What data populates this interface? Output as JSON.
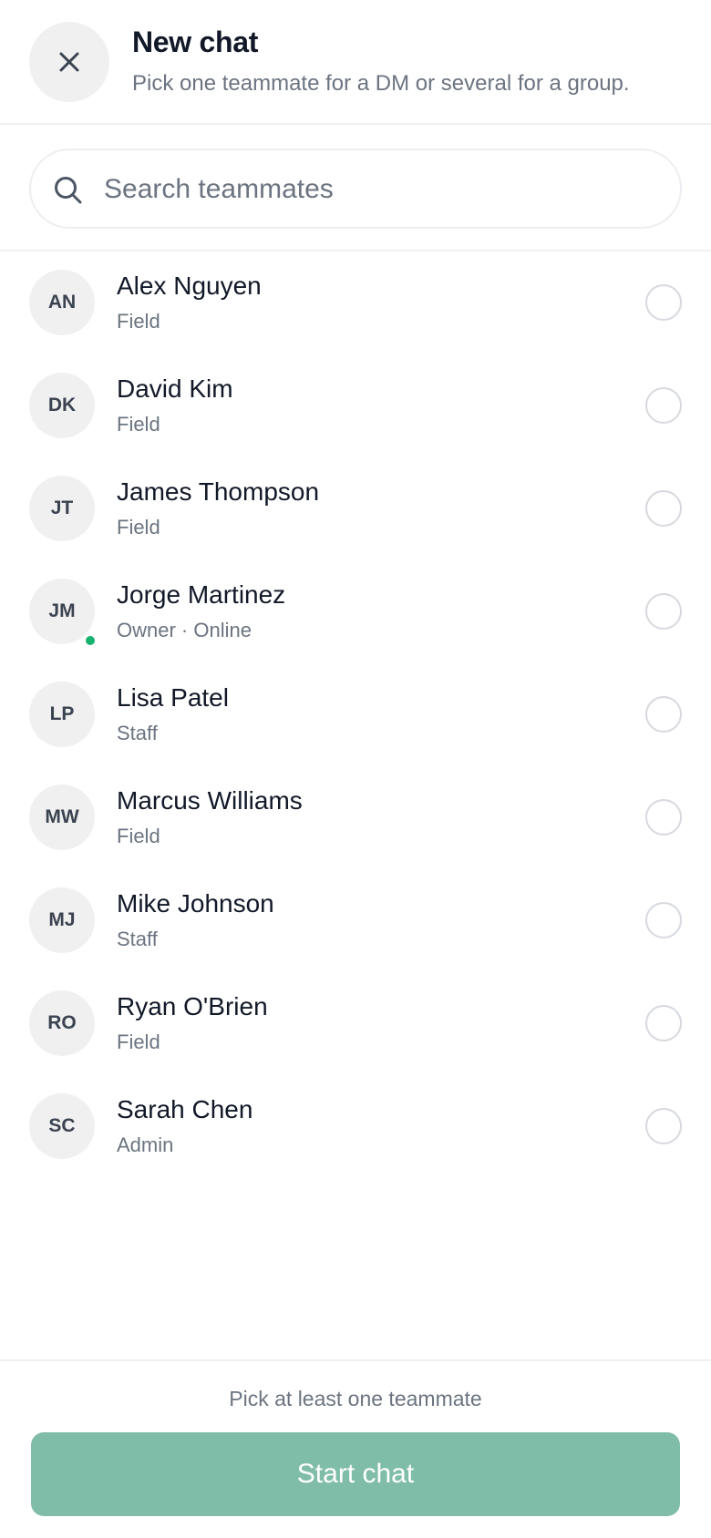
{
  "header": {
    "title": "New chat",
    "subtitle": "Pick one teammate for a DM or several for a group.",
    "close_icon": "close-icon"
  },
  "search": {
    "placeholder": "Search teammates",
    "value": "",
    "icon": "search-icon"
  },
  "teammates": [
    {
      "initials": "AN",
      "name": "Alex Nguyen",
      "role": "Field",
      "selected": false
    },
    {
      "initials": "DK",
      "name": "David Kim",
      "role": "Field",
      "selected": false
    },
    {
      "initials": "JT",
      "name": "James Thompson",
      "role": "Field",
      "selected": false
    },
    {
      "initials": "JM",
      "name": "Jorge Martinez",
      "role": "Owner · Online",
      "selected": false,
      "online": true
    },
    {
      "initials": "LP",
      "name": "Lisa Patel",
      "role": "Staff",
      "selected": false
    },
    {
      "initials": "MW",
      "name": "Marcus Williams",
      "role": "Field",
      "selected": false
    },
    {
      "initials": "MJ",
      "name": "Mike Johnson",
      "role": "Staff",
      "selected": false
    },
    {
      "initials": "RO",
      "name": "Ryan O'Brien",
      "role": "Field",
      "selected": false
    },
    {
      "initials": "SC",
      "name": "Sarah Chen",
      "role": "Admin",
      "selected": false
    }
  ],
  "footer": {
    "hint": "Pick at least one teammate",
    "start_label": "Start chat"
  },
  "colors": {
    "accent_disabled": "#80bda9",
    "online": "#16b36e",
    "muted_text": "#6b7480"
  }
}
